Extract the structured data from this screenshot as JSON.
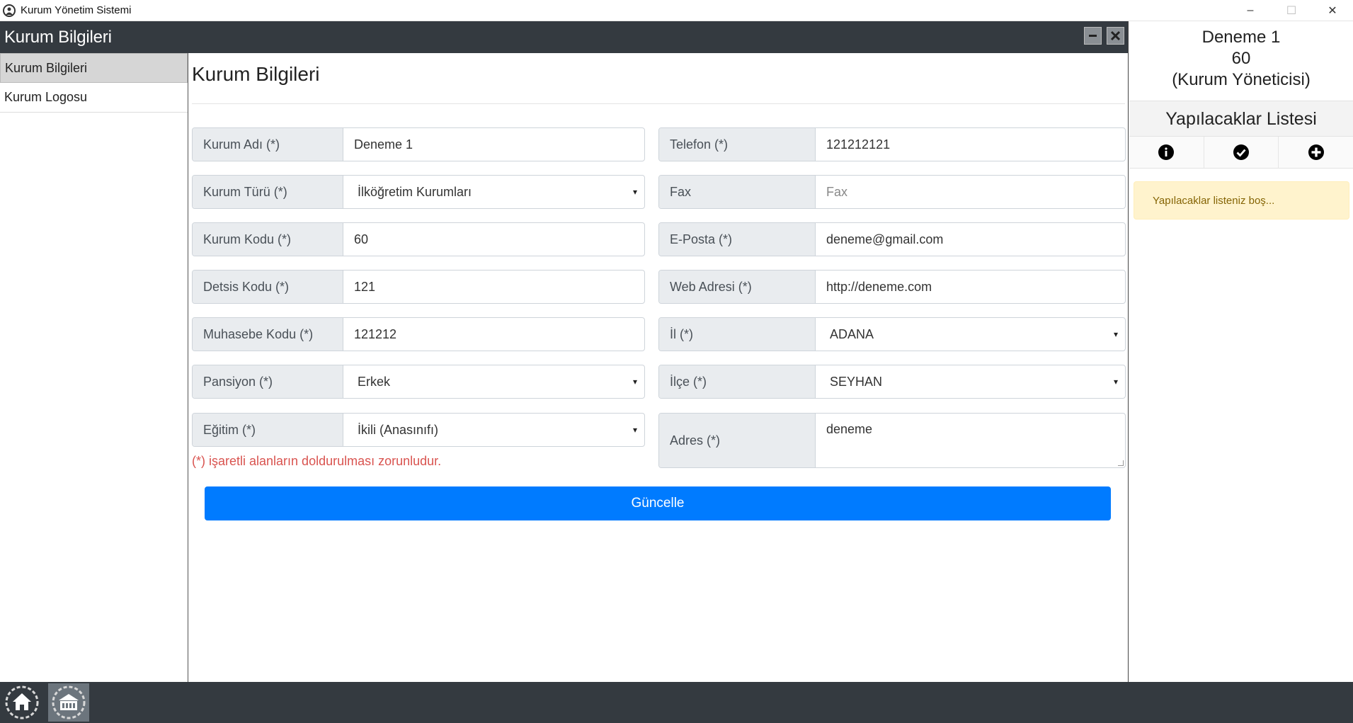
{
  "window": {
    "title": "Kurum Yönetim Sistemi",
    "minimize": "–",
    "maximize": "☐",
    "close": "✕"
  },
  "module": {
    "title": "Kurum Bilgileri"
  },
  "sidebar": {
    "items": [
      {
        "label": "Kurum Bilgileri",
        "active": true
      },
      {
        "label": "Kurum Logosu",
        "active": false
      }
    ]
  },
  "page": {
    "title": "Kurum Bilgileri"
  },
  "form": {
    "kurum_adi": {
      "label": "Kurum Adı (*)",
      "value": "Deneme 1"
    },
    "kurum_turu": {
      "label": "Kurum Türü (*)",
      "value": "İlköğretim Kurumları"
    },
    "kurum_kodu": {
      "label": "Kurum Kodu (*)",
      "value": "60"
    },
    "detsis_kodu": {
      "label": "Detsis Kodu (*)",
      "value": "121"
    },
    "muhasebe_kodu": {
      "label": "Muhasebe Kodu (*)",
      "value": "121212"
    },
    "pansiyon": {
      "label": "Pansiyon (*)",
      "value": "Erkek"
    },
    "egitim": {
      "label": "Eğitim (*)",
      "value": "İkili (Anasınıfı)"
    },
    "telefon": {
      "label": "Telefon (*)",
      "value": "121212121"
    },
    "fax": {
      "label": "Fax",
      "value": "",
      "placeholder": "Fax"
    },
    "eposta": {
      "label": "E-Posta (*)",
      "value": "deneme@gmail.com"
    },
    "web": {
      "label": "Web Adresi (*)",
      "value": "http://deneme.com"
    },
    "il": {
      "label": "İl (*)",
      "value": "ADANA"
    },
    "ilce": {
      "label": "İlçe (*)",
      "value": "SEYHAN"
    },
    "adres": {
      "label": "Adres (*)",
      "value": "deneme"
    },
    "required_note": "(*) işaretli alanların doldurulması zorunludur.",
    "submit_label": "Güncelle",
    "caret": "▾"
  },
  "user": {
    "name": "Deneme 1",
    "code": "60",
    "role": "(Kurum Yöneticisi)"
  },
  "todo": {
    "title": "Yapılacaklar Listesi",
    "empty_message": "Yapılacaklar listeniz boş..."
  },
  "colors": {
    "primary": "#007bff",
    "dark_bar": "#343a40",
    "required_text": "#d9534f",
    "alert_bg": "#fff3cd"
  }
}
